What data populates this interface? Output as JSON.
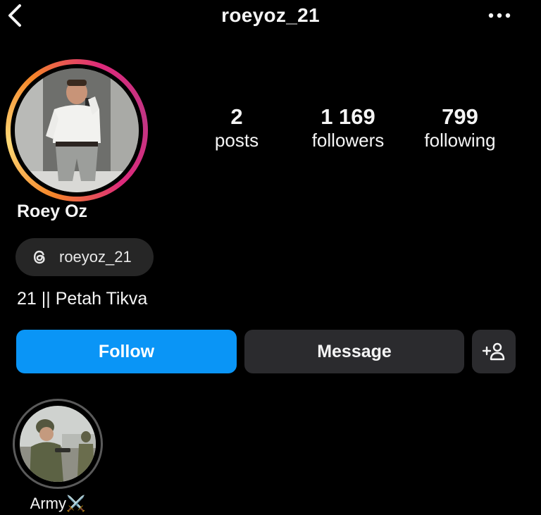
{
  "header": {
    "username": "roeyoz_21",
    "back_icon": "chevron-left-icon",
    "more_icon": "more-horizontal-icon"
  },
  "profile": {
    "display_name": "Roey Oz",
    "threads_handle": "roeyoz_21",
    "bio": "21 || Petah Tikva"
  },
  "stats": {
    "posts": {
      "value": "2",
      "label": "posts"
    },
    "followers": {
      "value": "1 169",
      "label": "followers"
    },
    "following": {
      "value": "799",
      "label": "following"
    }
  },
  "actions": {
    "follow_label": "Follow",
    "message_label": "Message",
    "add_user_icon": "add-user-icon"
  },
  "highlights": [
    {
      "label": "Army⚔️"
    }
  ],
  "colors": {
    "background": "#000000",
    "follow_blue": "#0a95f6",
    "secondary_button": "#2b2b2e",
    "pill": "#262626"
  }
}
